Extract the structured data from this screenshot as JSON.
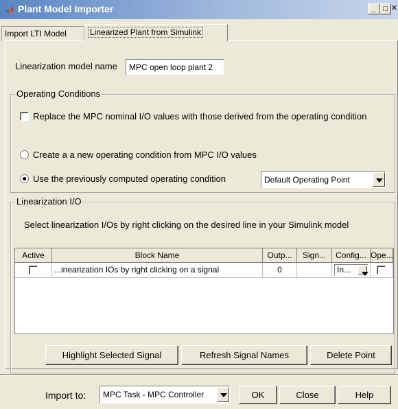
{
  "window": {
    "title": "Plant Model Importer",
    "controls": [
      "_",
      "□",
      "×"
    ]
  },
  "tabs": [
    {
      "label": "Import LTI Model",
      "active": false
    },
    {
      "label": "Linearized Plant from Simulink",
      "active": true
    }
  ],
  "model_name": {
    "label": "Linearization model name",
    "value": "MPC open loop plant 2"
  },
  "operating_conditions": {
    "title": "Operating Conditions",
    "replace_checkbox_label": "Replace the MPC nominal I/O values with those derived from the operating condition",
    "replace_checked": false,
    "radio_new_label": "Create a a new operating condition from MPC I/O values",
    "radio_prev_label": "Use the previously computed operating condition",
    "selected_radio": "previous",
    "op_point_value": "Default Operating Point"
  },
  "linearization_io": {
    "title": "Linearization I/O",
    "instruction": "Select linearization I/Os by right clicking on the desired line in your Simulink model",
    "columns": [
      "Active",
      "Block Name",
      "Outp...",
      "Sign...",
      "Config...",
      "Ope..."
    ],
    "rows": [
      {
        "active": false,
        "block_name": "...inearization IOs by right clicking on a signal",
        "output": "0",
        "signal": "",
        "config": "In...",
        "open": false
      }
    ],
    "buttons": {
      "highlight": "Highlight Selected Signal",
      "refresh": "Refresh Signal Names",
      "delete": "Delete Point"
    }
  },
  "footer": {
    "import_to_label": "Import to:",
    "import_to_value": "MPC Task - MPC Controller",
    "ok": "OK",
    "close": "Close",
    "help": "Help"
  },
  "colors": {
    "title_gradient_start": "#5a86c4",
    "title_gradient_end": "#c8d6ea",
    "dialog_bg": "#ece9d8",
    "logo_orange": "#e8661c"
  }
}
